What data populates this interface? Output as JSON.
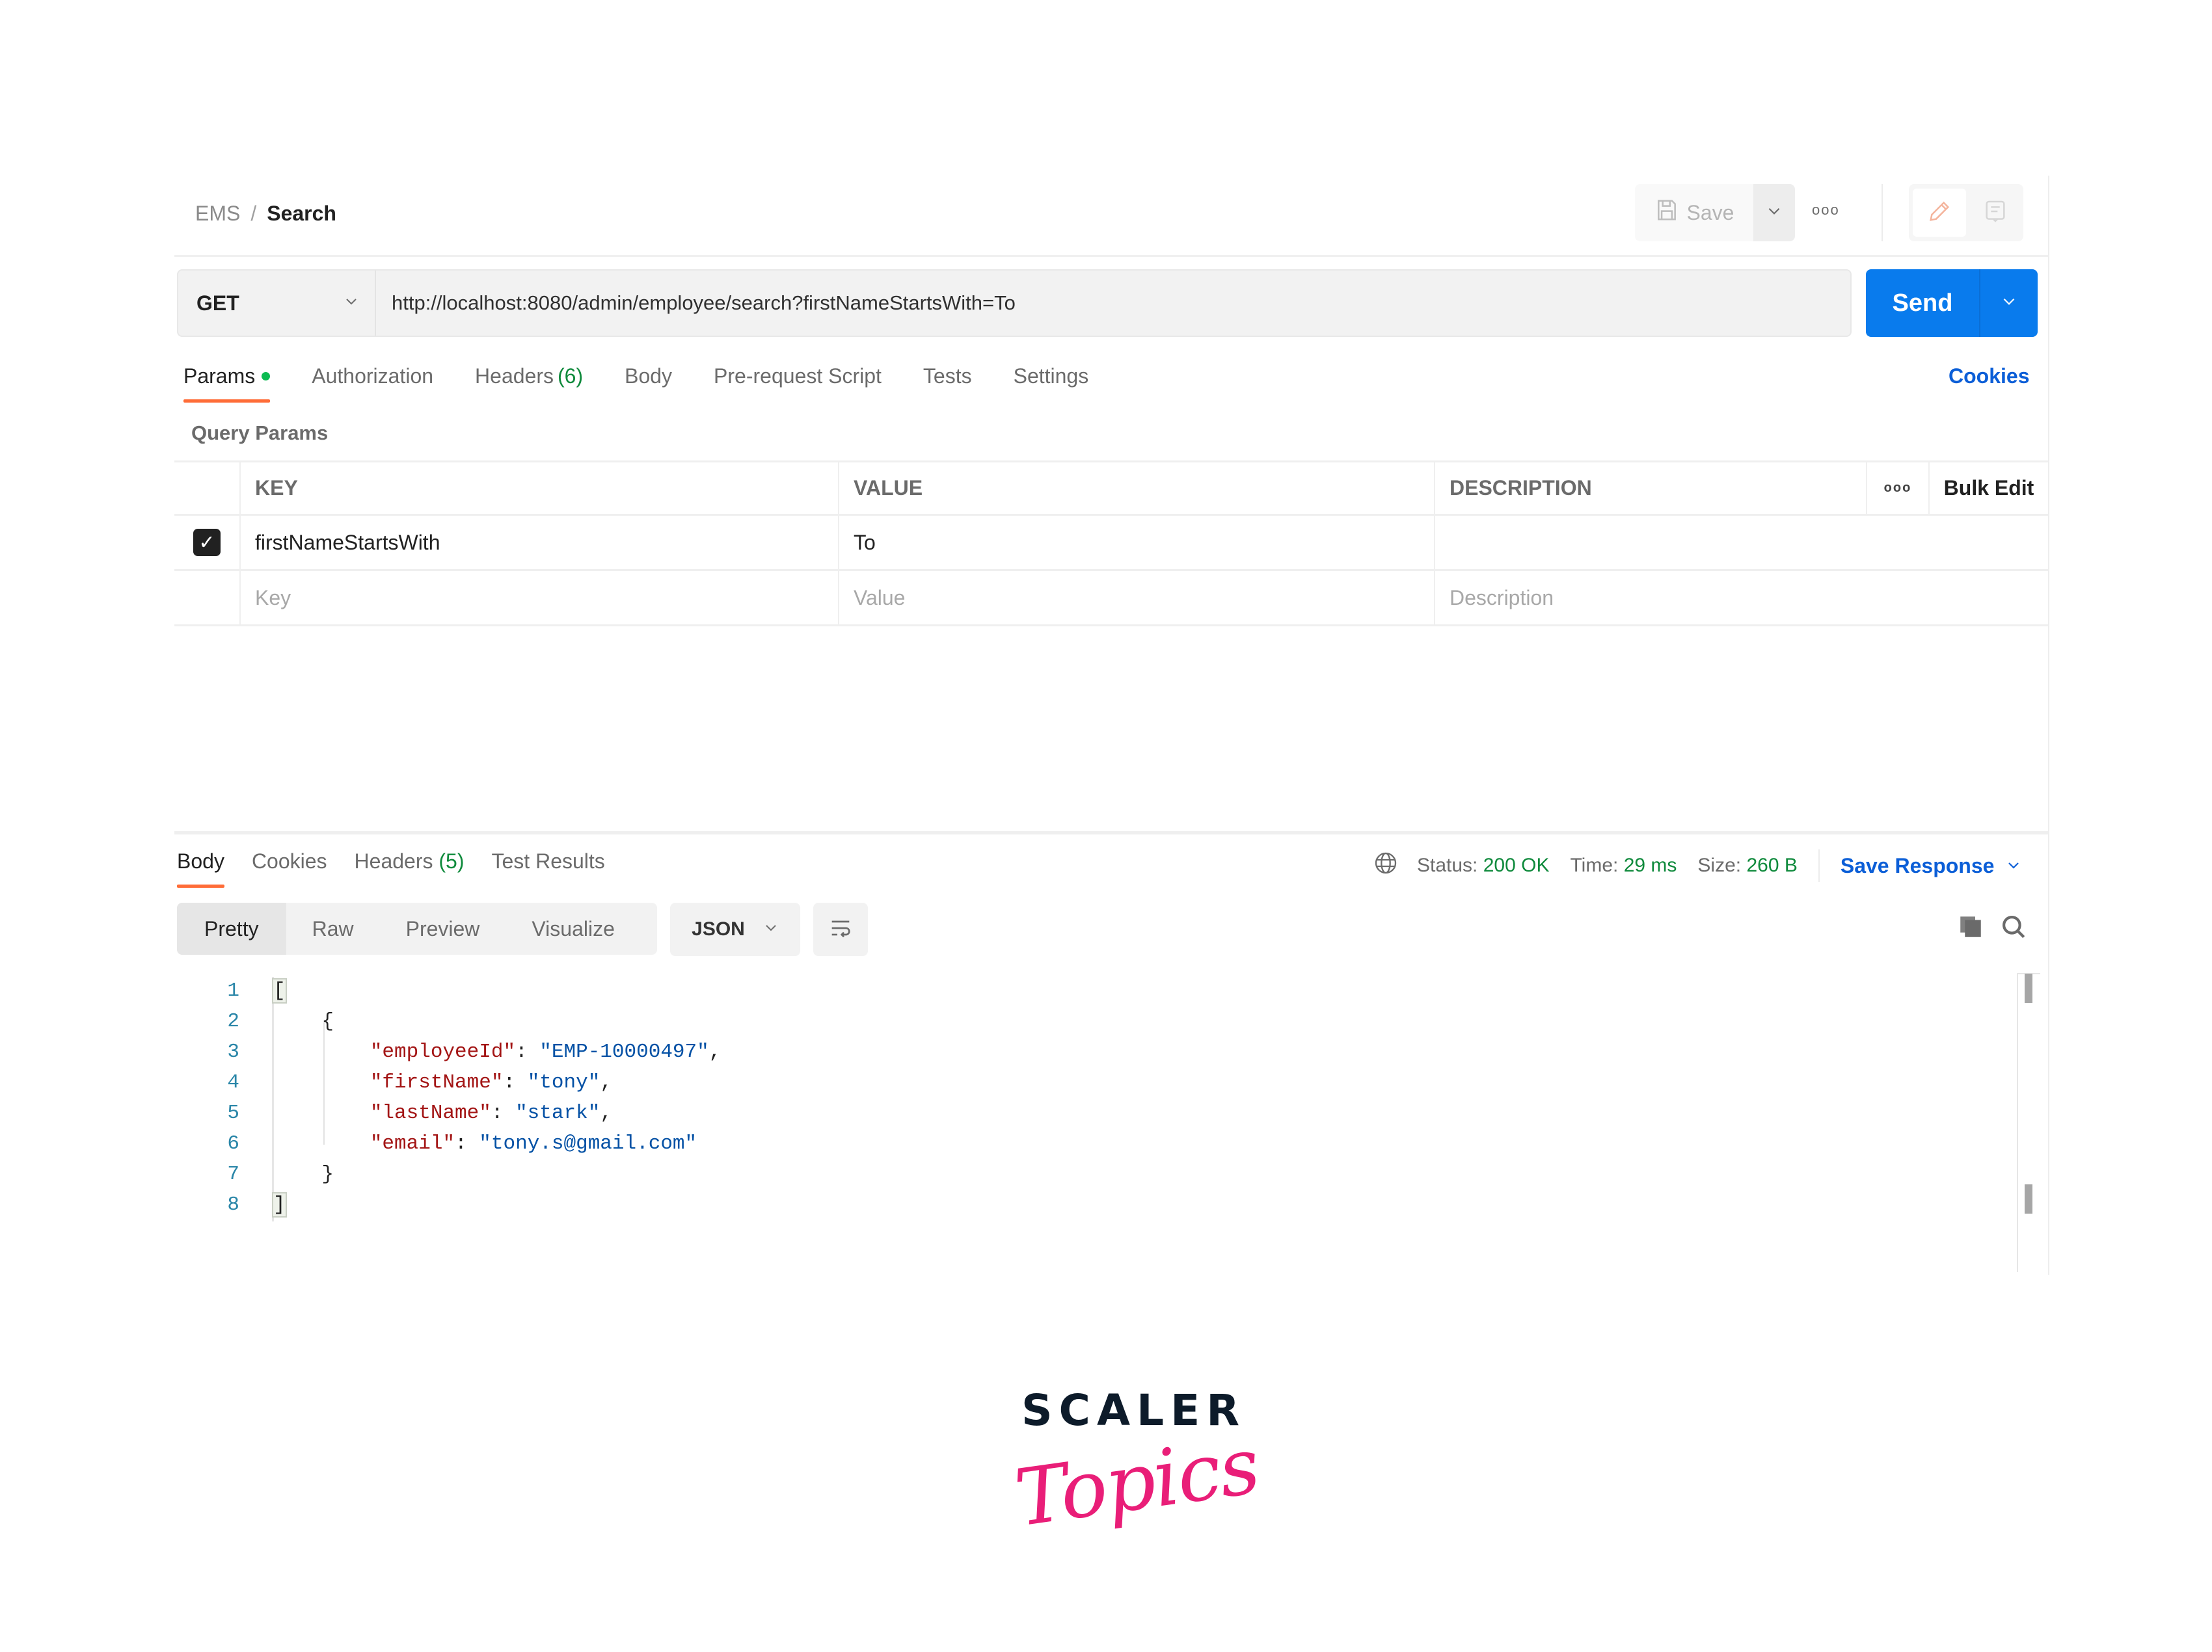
{
  "breadcrumb": {
    "parent": "EMS",
    "separator": "/",
    "current": "Search"
  },
  "header": {
    "save_label": "Save",
    "more_label": "ooo"
  },
  "request": {
    "method": "GET",
    "url": "http://localhost:8080/admin/employee/search?firstNameStartsWith=To",
    "send_label": "Send"
  },
  "request_tabs": [
    {
      "label": "Params",
      "active": true,
      "indicator": "green-dot"
    },
    {
      "label": "Authorization"
    },
    {
      "label": "Headers",
      "count": "(6)"
    },
    {
      "label": "Body"
    },
    {
      "label": "Pre-request Script"
    },
    {
      "label": "Tests"
    },
    {
      "label": "Settings"
    }
  ],
  "cookies_label": "Cookies",
  "query_params": {
    "title": "Query Params",
    "columns": {
      "key": "KEY",
      "value": "VALUE",
      "description": "DESCRIPTION",
      "more": "ooo",
      "bulk_edit": "Bulk Edit"
    },
    "rows": [
      {
        "checked": true,
        "key": "firstNameStartsWith",
        "value": "To",
        "description": ""
      }
    ],
    "placeholders": {
      "key": "Key",
      "value": "Value",
      "description": "Description"
    }
  },
  "response_tabs": [
    {
      "label": "Body",
      "active": true
    },
    {
      "label": "Cookies"
    },
    {
      "label": "Headers",
      "count": "(5)"
    },
    {
      "label": "Test Results"
    }
  ],
  "response_status": {
    "status_label": "Status:",
    "status_value": "200 OK",
    "time_label": "Time:",
    "time_value": "29 ms",
    "size_label": "Size:",
    "size_value": "260 B",
    "save_response_label": "Save Response"
  },
  "view_modes": [
    "Pretty",
    "Raw",
    "Preview",
    "Visualize"
  ],
  "active_view": "Pretty",
  "format": "JSON",
  "code_lines": [
    {
      "n": "1",
      "text": "["
    },
    {
      "n": "2",
      "text": "    {"
    },
    {
      "n": "3",
      "key": "\"employeeId\"",
      "value": "\"EMP-10000497\"",
      "trail": ","
    },
    {
      "n": "4",
      "key": "\"firstName\"",
      "value": "\"tony\"",
      "trail": ","
    },
    {
      "n": "5",
      "key": "\"lastName\"",
      "value": "\"stark\"",
      "trail": ","
    },
    {
      "n": "6",
      "key": "\"email\"",
      "value": "\"tony.s@gmail.com\"",
      "trail": ""
    },
    {
      "n": "7",
      "text": "    }"
    },
    {
      "n": "8",
      "text": "]"
    }
  ],
  "logo": {
    "line1": "SCALER",
    "line2": "Topics"
  },
  "colors": {
    "accent_send": "#097bed",
    "tab_underline": "#ff6c37",
    "success": "#0f8a3c",
    "link": "#0b5ed7",
    "json_key": "#a31515",
    "json_string": "#0451a5",
    "logo_pink": "#e91e78"
  }
}
